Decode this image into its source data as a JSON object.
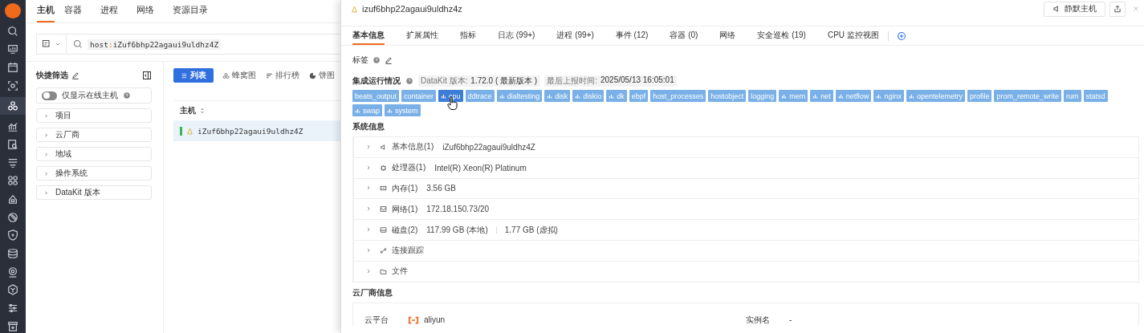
{
  "nav": [
    {
      "selected": false
    },
    {
      "selected": false
    },
    {
      "selected": false
    },
    {
      "selected": false
    },
    {
      "selected": true
    },
    {
      "selected": false
    },
    {
      "selected": false
    },
    {
      "selected": false
    },
    {
      "selected": false
    },
    {
      "selected": false
    },
    {
      "selected": false
    },
    {
      "selected": false
    },
    {
      "selected": false
    },
    {
      "selected": false
    },
    {
      "selected": false
    },
    {
      "selected": false
    },
    {
      "selected": false
    }
  ],
  "main_tabs": [
    {
      "label": "主机",
      "selected": true
    },
    {
      "label": "容器",
      "selected": false
    },
    {
      "label": "进程",
      "selected": false
    },
    {
      "label": "网络",
      "selected": false
    },
    {
      "label": "资源目录",
      "selected": false
    }
  ],
  "search": {
    "key": "host",
    "sep": ":",
    "value": "iZuf6bhp22agaui9uldhz4Z"
  },
  "quick_filter": {
    "title": "快捷筛选",
    "toggle": {
      "label": "仅显示在线主机",
      "on": false
    },
    "groups": [
      "项目",
      "云厂商",
      "地域",
      "操作系统",
      "DataKit 版本"
    ]
  },
  "views": [
    {
      "label": "列表",
      "selected": true
    },
    {
      "label": "蜂窝图",
      "selected": false
    },
    {
      "label": "排行榜",
      "selected": false
    },
    {
      "label": "饼图",
      "selected": false
    }
  ],
  "table": {
    "columns": [
      "主机"
    ],
    "rows": [
      {
        "host": "iZuf6bhp22agaui9uldhz4Z",
        "selected": true
      }
    ]
  },
  "drawer": {
    "title": "izuf6bhp22agaui9uldhz4z",
    "mute_button": "静默主机",
    "tabs": [
      {
        "label": "基本信息",
        "selected": true
      },
      {
        "label": "扩展属性",
        "selected": false
      },
      {
        "label": "指标",
        "selected": false
      },
      {
        "label": "日志 (99+)",
        "selected": false
      },
      {
        "label": "进程 (99+)",
        "selected": false
      },
      {
        "label": "事件 (12)",
        "selected": false
      },
      {
        "label": "容器 (0)",
        "selected": false
      },
      {
        "label": "网络",
        "selected": false
      },
      {
        "label": "安全巡检 (19)",
        "selected": false
      },
      {
        "label": "CPU 监控视图",
        "selected": false
      }
    ],
    "labels_title": "标签",
    "integration": {
      "title": "集成运行情况",
      "version_label": "DataKit 版本:",
      "version": "1.72.0 ( 最新版本 )",
      "report_label": "最后上报时间:",
      "report_time": "2025/05/13 16:05:01",
      "tags": [
        {
          "name": "beats_output",
          "chart": false,
          "hovered": false
        },
        {
          "name": "container",
          "chart": false,
          "hovered": false
        },
        {
          "name": "cpu",
          "chart": true,
          "hovered": true
        },
        {
          "name": "ddtrace",
          "chart": false,
          "hovered": false
        },
        {
          "name": "dialtesting",
          "chart": true,
          "hovered": false
        },
        {
          "name": "disk",
          "chart": true,
          "hovered": false
        },
        {
          "name": "diskio",
          "chart": true,
          "hovered": false
        },
        {
          "name": "dk",
          "chart": true,
          "hovered": false
        },
        {
          "name": "ebpf",
          "chart": false,
          "hovered": false
        },
        {
          "name": "host_processes",
          "chart": false,
          "hovered": false
        },
        {
          "name": "hostobject",
          "chart": false,
          "hovered": false
        },
        {
          "name": "logging",
          "chart": false,
          "hovered": false
        },
        {
          "name": "mem",
          "chart": true,
          "hovered": false
        },
        {
          "name": "net",
          "chart": true,
          "hovered": false
        },
        {
          "name": "netflow",
          "chart": true,
          "hovered": false
        },
        {
          "name": "nginx",
          "chart": true,
          "hovered": false
        },
        {
          "name": "opentelemetry",
          "chart": true,
          "hovered": false
        },
        {
          "name": "profile",
          "chart": false,
          "hovered": false
        },
        {
          "name": "prom_remote_write",
          "chart": false,
          "hovered": false
        },
        {
          "name": "rum",
          "chart": false,
          "hovered": false
        },
        {
          "name": "statsd",
          "chart": false,
          "hovered": false
        },
        {
          "name": "swap",
          "chart": true,
          "hovered": false
        },
        {
          "name": "system",
          "chart": true,
          "hovered": false
        }
      ]
    },
    "system_title": "系统信息",
    "system_rows": [
      {
        "kind": "basic",
        "label": "基本信息(1)",
        "values": [
          "iZuf6bhp22agaui9uldhz4Z"
        ]
      },
      {
        "kind": "cpu",
        "label": "处理器(1)",
        "values": [
          "Intel(R) Xeon(R) Platinum"
        ]
      },
      {
        "kind": "memory",
        "label": "内存(1)",
        "values": [
          "3.56 GB"
        ]
      },
      {
        "kind": "network",
        "label": "网络(1)",
        "values": [
          "172.18.150.73/20"
        ]
      },
      {
        "kind": "disk",
        "label": "磁盘(2)",
        "values": [
          "117.99 GB (本地)",
          "1.77 GB (虚拟)"
        ]
      },
      {
        "kind": "connection",
        "label": "连接跟踪"
      },
      {
        "kind": "file",
        "label": "文件"
      }
    ],
    "cloud_title": "云厂商信息",
    "cloud_fields": [
      {
        "label": "云平台",
        "value": "aliyun",
        "kind": "provider"
      },
      {
        "label": "实例名",
        "value": "-",
        "kind": "text"
      }
    ]
  }
}
